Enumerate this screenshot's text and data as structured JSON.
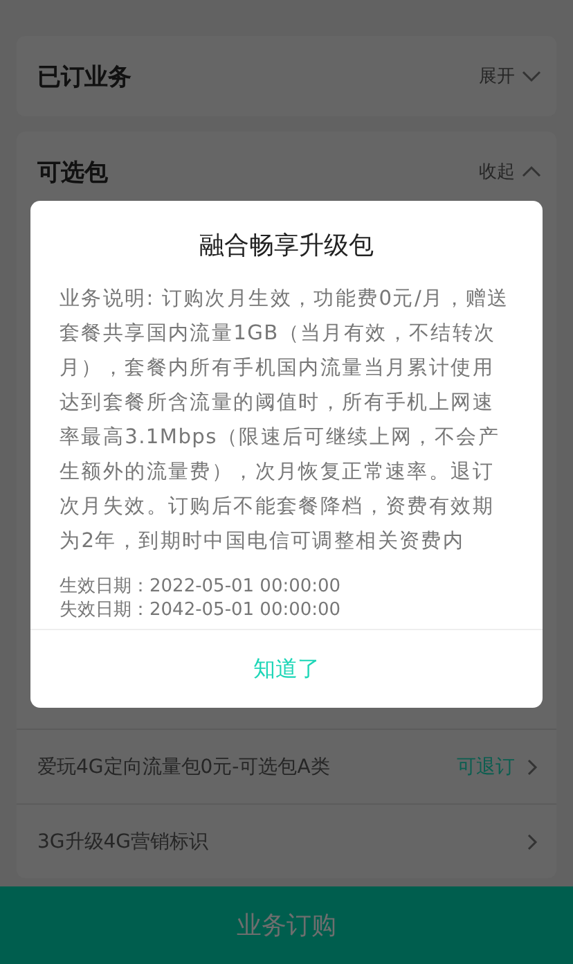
{
  "sections": [
    {
      "title": "已订业务",
      "toggle": "展开",
      "expanded": false
    },
    {
      "title": "可选包",
      "toggle": "收起",
      "expanded": true,
      "items": [
        {
          "name": "爱玩4G定向流量包0元-可选包A类",
          "action": "可退订"
        },
        {
          "name": "3G升级4G营销标识"
        }
      ]
    }
  ],
  "dialog": {
    "title": "融合畅享升级包",
    "description": "业务说明: 订购次月生效，功能费0元/月，赠送套餐共享国内流量1GB（当月有效，不结转次月），套餐内所有手机国内流量当月累计使用达到套餐所含流量的阈值时，所有手机上网速率最高3.1Mbps（限速后可继续上网，不会产生额外的流量费），次月恢复正常速率。退订次月失效。订购后不能套餐降档，资费有效期为2年，到期时中国电信可调整相关资费内",
    "dates": [
      "生效日期：2022-05-01 00:00:00",
      "失效日期：2042-05-01 00:00:00"
    ],
    "button": "知道了"
  },
  "bottom_button": "业务订购"
}
